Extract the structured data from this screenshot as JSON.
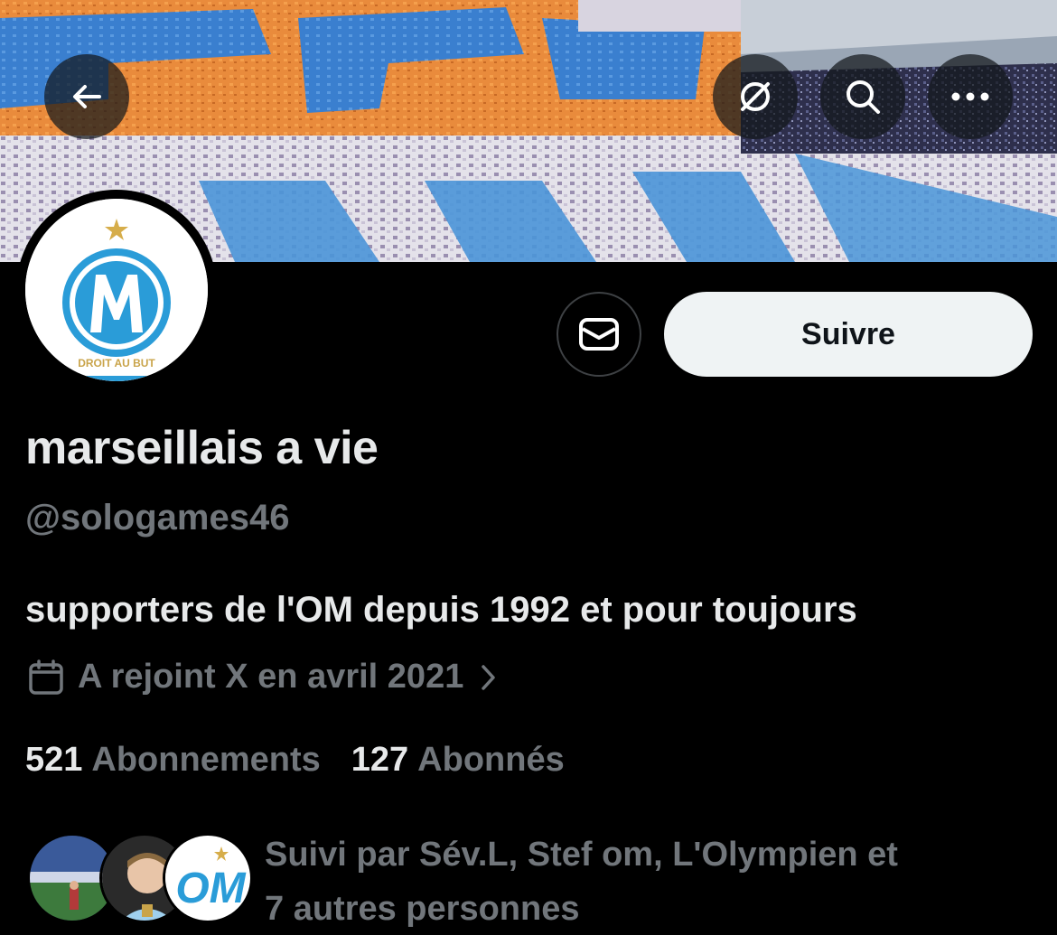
{
  "header": {
    "back_icon": "arrow-left-icon",
    "actions": [
      "circle-slash-icon",
      "search-icon",
      "more-horizontal-icon"
    ]
  },
  "profile": {
    "avatar_icon": "om-logo",
    "avatar_text": "DROIT AU BUT",
    "display_name": "marseillais a vie",
    "handle": "@sologames46",
    "bio": "supporters de l'OM depuis 1992 et pour toujours",
    "joined": "A rejoint X en avril 2021",
    "following_count": "521",
    "following_label": "Abonnements",
    "followers_count": "127",
    "followers_label": "Abonnés"
  },
  "buttons": {
    "message_icon": "envelope-icon",
    "follow_label": "Suivre"
  },
  "followed_by": {
    "line1": "Suivi par Sév.L, Stef om, L'Olympien et",
    "line2": "7 autres personnes"
  },
  "colors": {
    "background": "#000000",
    "text_primary": "#e7e9ea",
    "text_secondary": "#71767b",
    "button_bg": "#eff3f4",
    "om_blue": "#2a9cd8"
  }
}
